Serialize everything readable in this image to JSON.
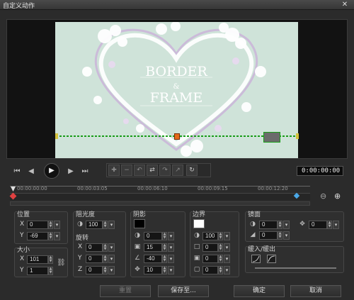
{
  "window": {
    "title": "自定义动作"
  },
  "preview": {
    "title_line1": "BORDER",
    "title_amp": "&",
    "title_line2": "FRAME"
  },
  "playback": {
    "timecode": "0:00:00:00"
  },
  "timeline": {
    "ticks": [
      "00:00:00:00",
      "00:00:03:05",
      "00:00:06:10",
      "00:00:09:15",
      "00:00:12:20"
    ]
  },
  "position": {
    "label": "位置",
    "x_label": "X",
    "x_value": "0",
    "y_label": "Y",
    "y_value": "-69"
  },
  "size": {
    "label": "大小",
    "x_label": "X",
    "x_value": "101",
    "y_label": "Y",
    "y_value": "1"
  },
  "opacity": {
    "label": "阻光度",
    "value": "100"
  },
  "rotation": {
    "label": "旋转",
    "x_label": "X",
    "x_value": "0",
    "y_label": "Y",
    "y_value": "0",
    "z_label": "Z",
    "z_value": "0"
  },
  "shadow": {
    "label": "阴影",
    "color": "#000000",
    "opacity": "0",
    "blur": "15",
    "angle": "-40",
    "distance": "10"
  },
  "border": {
    "label": "边界",
    "color": "#ffffff",
    "opacity": "100",
    "width": "0",
    "v2": "0",
    "v3": "0"
  },
  "mirror": {
    "label": "镜面",
    "opacity": "0",
    "v2": "0",
    "offset": "0"
  },
  "fade": {
    "label": "缓入/缓出"
  },
  "buttons": {
    "reset": "重置",
    "save_to": "保存至...",
    "ok": "确定",
    "cancel": "取消"
  }
}
